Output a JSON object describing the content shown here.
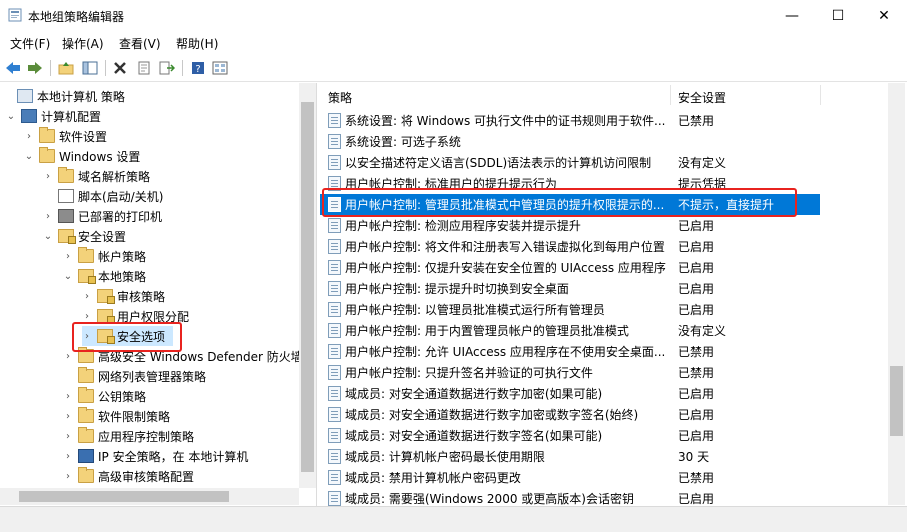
{
  "window": {
    "title": "本地组策略编辑器",
    "buttons": {
      "minimize": "—",
      "maximize": "☐",
      "close": "✕"
    }
  },
  "menu": [
    "文件(F)",
    "操作(A)",
    "查看(V)",
    "帮助(H)"
  ],
  "tree": [
    {
      "label": "本地计算机 策略",
      "icon": "computer-policy-icon",
      "twisty": ""
    },
    {
      "label": "计算机配置",
      "icon": "computer-icon",
      "twisty": "⌄"
    },
    {
      "label": "软件设置",
      "icon": "folder-icon",
      "twisty": "›"
    },
    {
      "label": "Windows 设置",
      "icon": "folder-icon",
      "twisty": "⌄"
    },
    {
      "label": "域名解析策略",
      "icon": "folder-icon",
      "twisty": "›"
    },
    {
      "label": "脚本(启动/关机)",
      "icon": "script-icon",
      "twisty": ""
    },
    {
      "label": "已部署的打印机",
      "icon": "printer-icon",
      "twisty": "›"
    },
    {
      "label": "安全设置",
      "icon": "security-folder-icon",
      "twisty": "⌄"
    },
    {
      "label": "帐户策略",
      "icon": "folder-icon",
      "twisty": "›"
    },
    {
      "label": "本地策略",
      "icon": "security-folder-icon",
      "twisty": "⌄"
    },
    {
      "label": "审核策略",
      "icon": "security-folder-icon",
      "twisty": "›"
    },
    {
      "label": "用户权限分配",
      "icon": "security-folder-icon",
      "twisty": "›"
    },
    {
      "label": "安全选项",
      "icon": "security-folder-icon",
      "twisty": "›"
    },
    {
      "label": "高级安全 Windows Defender 防火墙",
      "icon": "firewall-icon",
      "twisty": "›"
    },
    {
      "label": "网络列表管理器策略",
      "icon": "folder-icon",
      "twisty": ""
    },
    {
      "label": "公钥策略",
      "icon": "folder-icon",
      "twisty": "›"
    },
    {
      "label": "软件限制策略",
      "icon": "folder-icon",
      "twisty": "›"
    },
    {
      "label": "应用程序控制策略",
      "icon": "folder-icon",
      "twisty": "›"
    },
    {
      "label": "IP 安全策略，在 本地计算机",
      "icon": "ipsec-icon",
      "twisty": "›"
    },
    {
      "label": "高级审核策略配置",
      "icon": "folder-icon",
      "twisty": "›"
    }
  ],
  "list": {
    "headers": {
      "policy": "策略",
      "setting": "安全设置"
    },
    "rows": [
      {
        "policy": "系统设置: 将 Windows 可执行文件中的证书规则用于软件...",
        "setting": "已禁用"
      },
      {
        "policy": "系统设置: 可选子系统",
        "setting": ""
      },
      {
        "policy": "以安全描述符定义语言(SDDL)语法表示的计算机访问限制",
        "setting": "没有定义"
      },
      {
        "policy": "用户帐户控制: 标准用户的提升提示行为",
        "setting": "提示凭据"
      },
      {
        "policy": "用户帐户控制: 管理员批准模式中管理员的提升权限提示的...",
        "setting": "不提示，直接提升"
      },
      {
        "policy": "用户帐户控制: 检测应用程序安装并提示提升",
        "setting": "已启用"
      },
      {
        "policy": "用户帐户控制: 将文件和注册表写入错误虚拟化到每用户位置",
        "setting": "已启用"
      },
      {
        "policy": "用户帐户控制: 仅提升安装在安全位置的 UIAccess 应用程序",
        "setting": "已启用"
      },
      {
        "policy": "用户帐户控制: 提示提升时切换到安全桌面",
        "setting": "已启用"
      },
      {
        "policy": "用户帐户控制: 以管理员批准模式运行所有管理员",
        "setting": "已启用"
      },
      {
        "policy": "用户帐户控制: 用于内置管理员帐户的管理员批准模式",
        "setting": "没有定义"
      },
      {
        "policy": "用户帐户控制: 允许 UIAccess 应用程序在不使用安全桌面...",
        "setting": "已禁用"
      },
      {
        "policy": "用户帐户控制: 只提升签名并验证的可执行文件",
        "setting": "已禁用"
      },
      {
        "policy": "域成员: 对安全通道数据进行数字加密(如果可能)",
        "setting": "已启用"
      },
      {
        "policy": "域成员: 对安全通道数据进行数字加密或数字签名(始终)",
        "setting": "已启用"
      },
      {
        "policy": "域成员: 对安全通道数据进行数字签名(如果可能)",
        "setting": "已启用"
      },
      {
        "policy": "域成员: 计算机帐户密码最长使用期限",
        "setting": "30 天"
      },
      {
        "policy": "域成员: 禁用计算机帐户密码更改",
        "setting": "已禁用"
      },
      {
        "policy": "域成员: 需要强(Windows 2000 或更高版本)会话密钥",
        "setting": "已启用"
      }
    ],
    "selected_index": 4
  },
  "colors": {
    "selection": "#0078d7",
    "highlight_box": "#e8231f"
  }
}
